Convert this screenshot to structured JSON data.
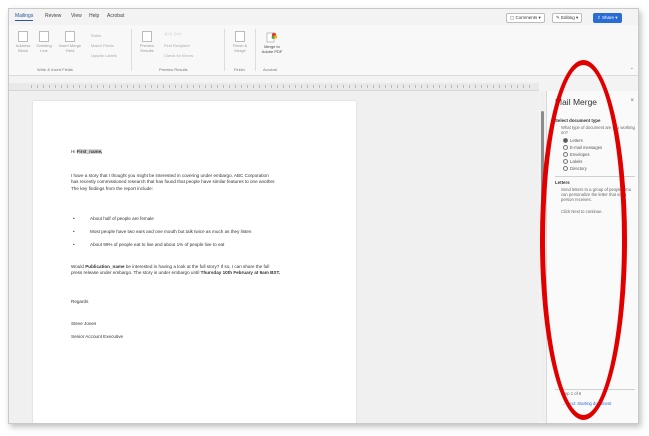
{
  "tabs": [
    "Mailings",
    "Review",
    "View",
    "Help",
    "Acrobat"
  ],
  "top_buttons": {
    "comments": "Comments",
    "editing": "Editing",
    "share": "Share"
  },
  "ribbon": {
    "write_insert": [
      "Address Block",
      "Greeting Line",
      "Insert Merge Field"
    ],
    "small_items": [
      "Rules",
      "Match Fields",
      "Update Labels",
      "Find Recipient",
      "Check for Errors"
    ],
    "preview": "Preview Results",
    "finish": "Finish & Merge",
    "acrobat": "Merge to Adobe PDF",
    "groups": {
      "write": "Write & Insert Fields",
      "preview": "Preview Results",
      "finish": "Finish",
      "acrobat": "Acrobat"
    }
  },
  "document": {
    "greeting_prefix": "Hi",
    "greeting_field": "First_name,",
    "para1_line1": "I have a story that I thought you might be interested in covering under embargo. ABC Corporation",
    "para1_line2": "has recently commissioned research that has found that people have similar features to one another.",
    "para1_line3": "The key findings from the report include:",
    "bullets": [
      "About half of people are female",
      "Most people have two ears and one mouth but talk twice as much as they listen",
      "About 99% of people eat to live and about 1% of people live to eat"
    ],
    "para2_line1_a": "Would",
    "para2_line1_field": "Publication_name",
    "para2_line1_b": "be interested in having a look at the full story? If so, I can share the full",
    "para2_line2_a": "press release under embargo. The story is under embargo until",
    "para2_line2_b": "Thursday 10th February at 9am BST.",
    "regards": "Regards",
    "sig_name": "Steve Jones",
    "sig_title": "Senior Account Executive"
  },
  "pane": {
    "title": "Mail Merge",
    "close": "×",
    "section1": "Select document type",
    "section1_text": "What type of document are you working on?",
    "options": [
      "Letters",
      "E-mail messages",
      "Envelopes",
      "Labels",
      "Directory"
    ],
    "selected_option": "Letters",
    "section2": "Letters",
    "section2_text": "Send letters to a group of people. You can personalize the letter that each person receives.",
    "section2_next": "Click Next to continue.",
    "step": "Step 1 of 6",
    "next_link": "Next: Starting document"
  },
  "colors": {
    "accent": "#2b579a",
    "share": "#2b6cd4",
    "annotation": "#e00000"
  }
}
